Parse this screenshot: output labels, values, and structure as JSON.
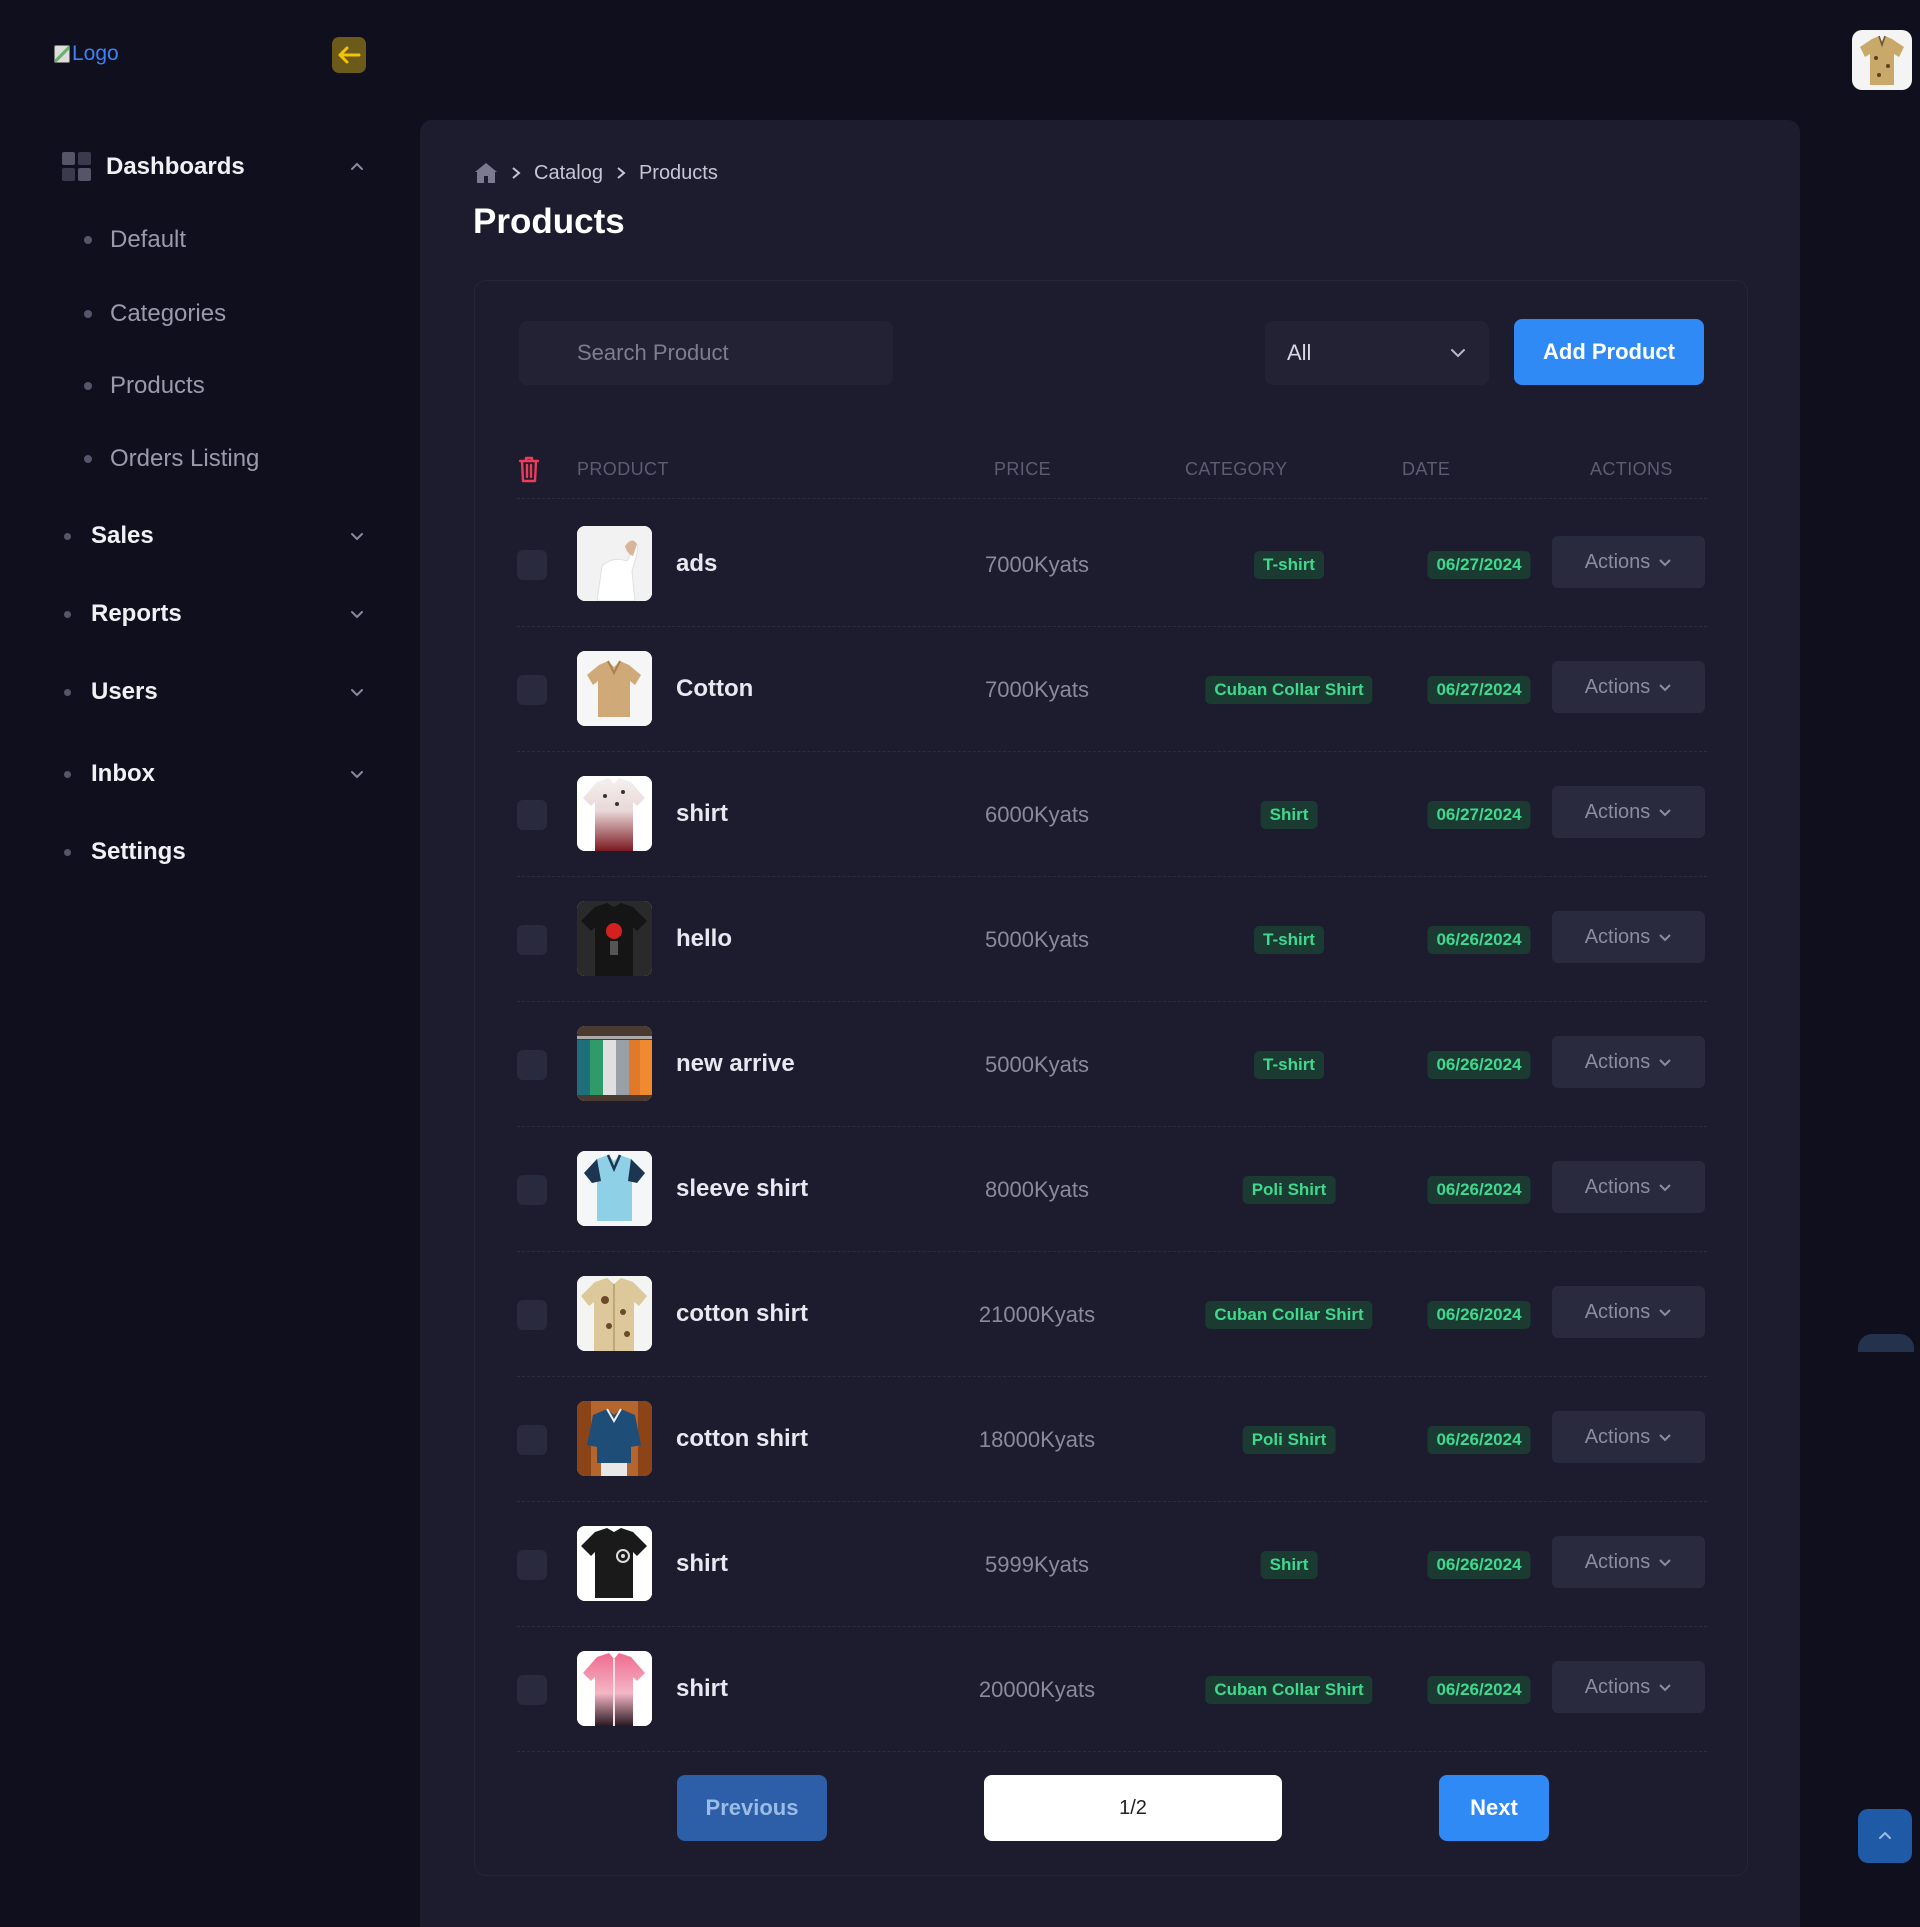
{
  "app": {
    "logo_alt": "Logo"
  },
  "sidebar": {
    "dashboards_label": "Dashboards",
    "sub_items": [
      "Default",
      "Categories",
      "Products",
      "Orders Listing"
    ],
    "items": [
      "Sales",
      "Reports",
      "Users",
      "Inbox",
      "Settings"
    ]
  },
  "breadcrumb": {
    "items": [
      "Catalog",
      "Products"
    ]
  },
  "page": {
    "title": "Products"
  },
  "toolbar": {
    "search_placeholder": "Search Product",
    "filter_value": "All",
    "add_label": "Add Product"
  },
  "table": {
    "headers": {
      "product": "PRODUCT",
      "price": "PRICE",
      "category": "CATEGORY",
      "date": "DATE",
      "actions": "ACTIONS"
    },
    "action_label": "Actions",
    "rows": [
      {
        "name": "ads",
        "price": "7000Kyats",
        "category": "T-shirt",
        "date": "06/27/2024",
        "image": "white-tshirt-arm"
      },
      {
        "name": "Cotton",
        "price": "7000Kyats",
        "category": "Cuban Collar Shirt",
        "date": "06/27/2024",
        "image": "beige-polo"
      },
      {
        "name": "shirt",
        "price": "6000Kyats",
        "category": "Shirt",
        "date": "06/27/2024",
        "image": "red-gradient-shirt"
      },
      {
        "name": "hello",
        "price": "5000Kyats",
        "category": "T-shirt",
        "date": "06/26/2024",
        "image": "black-graphic-tshirt"
      },
      {
        "name": "new arrive",
        "price": "5000Kyats",
        "category": "T-shirt",
        "date": "06/26/2024",
        "image": "colorful-shirts-rack"
      },
      {
        "name": "sleeve shirt",
        "price": "8000Kyats",
        "category": "Poli Shirt",
        "date": "06/26/2024",
        "image": "light-blue-polo"
      },
      {
        "name": "cotton shirt",
        "price": "21000Kyats",
        "category": "Cuban Collar Shirt",
        "date": "06/26/2024",
        "image": "beige-print-shirt"
      },
      {
        "name": "cotton shirt",
        "price": "18000Kyats",
        "category": "Poli Shirt",
        "date": "06/26/2024",
        "image": "navy-polo-model"
      },
      {
        "name": "shirt",
        "price": "5999Kyats",
        "category": "Shirt",
        "date": "06/26/2024",
        "image": "black-tshirt-print"
      },
      {
        "name": "shirt",
        "price": "20000Kyats",
        "category": "Cuban Collar Shirt",
        "date": "06/26/2024",
        "image": "pink-gradient-shirt"
      }
    ]
  },
  "pagination": {
    "prev_label": "Previous",
    "page_info": "1/2",
    "next_label": "Next"
  },
  "colors": {
    "accent": "#2f8af5",
    "badge_text": "#3fd98d",
    "badge_bg": "#1b3a32",
    "danger": "#ef3b5a"
  }
}
